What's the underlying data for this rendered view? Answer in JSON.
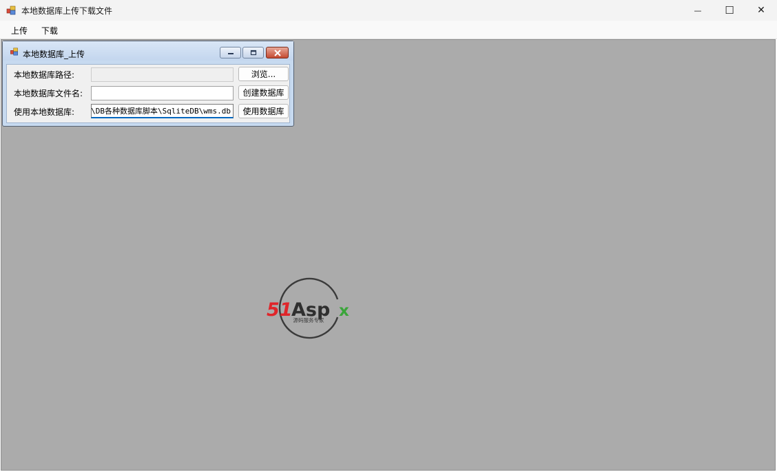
{
  "window": {
    "title": "本地数据库上传下载文件",
    "minimize_glyph": "—",
    "maximize_glyph": "☐",
    "close_glyph": "✕"
  },
  "menu": {
    "items": [
      {
        "label": "上传"
      },
      {
        "label": "下载"
      }
    ]
  },
  "child": {
    "title": "本地数据库_上传",
    "rows": [
      {
        "label": "本地数据库路径:",
        "value": "",
        "button": "浏览..."
      },
      {
        "label": "本地数据库文件名:",
        "value": "",
        "button": "创建数据库"
      },
      {
        "label": "使用本地数据库:",
        "value": "t\\DB各种数据库脚本\\SqliteDB\\wms.db",
        "button": "使用数据库"
      }
    ]
  },
  "watermark": {
    "brand": "51Aspx",
    "tagline": "源码服务专家",
    "colors": {
      "red": "#e0252a",
      "green": "#3aa53a",
      "dark": "#333333"
    }
  },
  "colors": {
    "mdi_background": "#ababab",
    "accent": "#0067c0"
  }
}
